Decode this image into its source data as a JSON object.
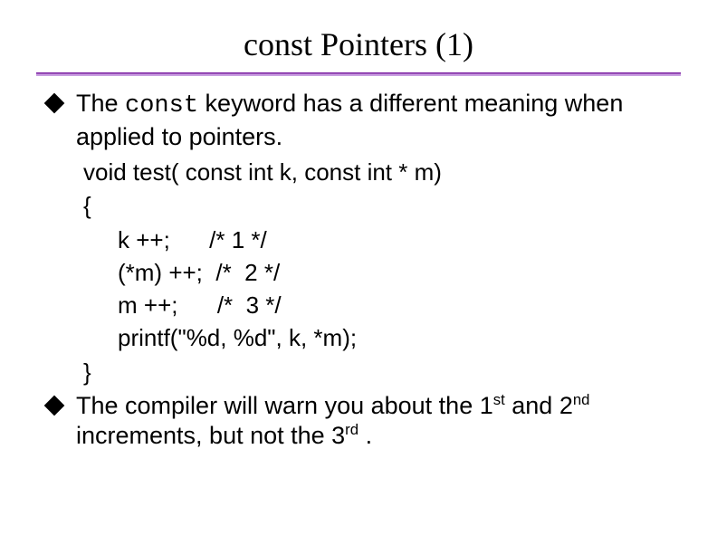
{
  "title": "const Pointers (1)",
  "bullet1": {
    "pre": "The ",
    "kw": "const",
    "post": " keyword has a different meaning when applied to pointers."
  },
  "code": {
    "sig": "void test( const int k, const int * m)",
    "open": "{",
    "l1": "k ++;      /* 1 */",
    "l2": "(*m) ++;  /*  2 */",
    "l3": "m ++;      /*  3 */",
    "l4": "printf(\"%d, %d\", k, *m);",
    "close": "}"
  },
  "bullet2": {
    "p1": "The compiler will warn you about the 1",
    "s1": "st",
    "p2": " and 2",
    "s2": "nd",
    "p3": " increments, but not the 3",
    "s3": "rd",
    "p4": " ."
  }
}
